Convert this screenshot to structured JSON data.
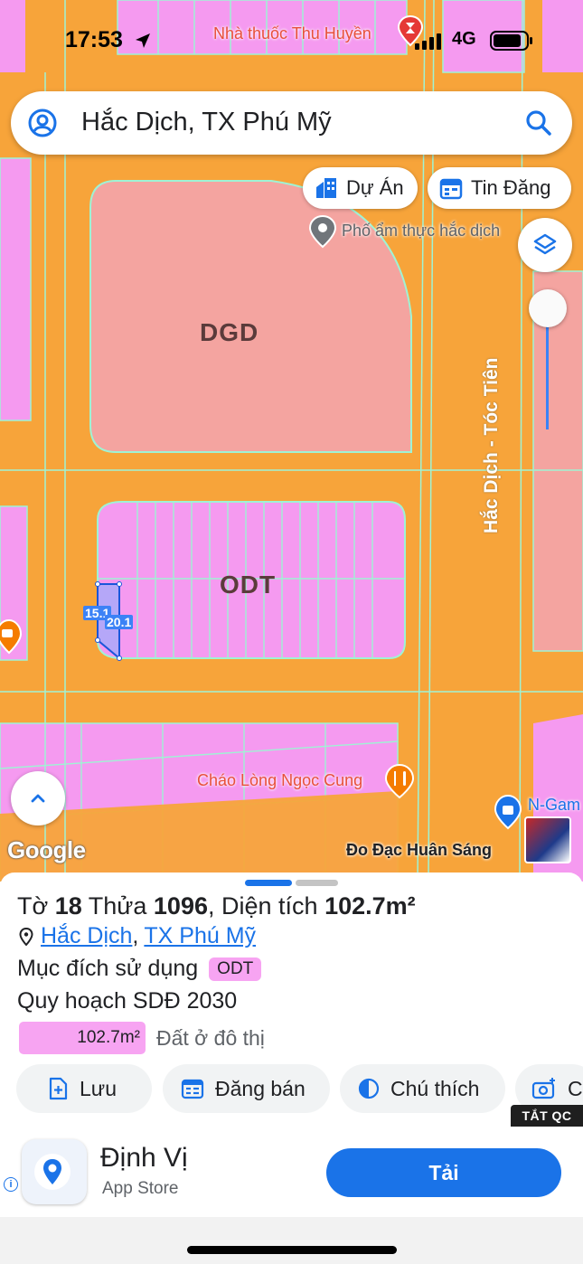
{
  "status_bar": {
    "time": "17:53",
    "network": "4G"
  },
  "search": {
    "query": "Hắc Dịch, TX Phú Mỹ"
  },
  "map": {
    "chips": {
      "projects": "Dự Án",
      "listings": "Tin Đăng"
    },
    "pois": {
      "pharmacy": "Nhà thuốc Thu Huyền",
      "food_street": "Phố ẩm thực hắc dịch",
      "restaurant": "Cháo Lòng Ngọc Cung",
      "game_shop": "N-Gam",
      "brand": "Đo Đạc Huân Sáng"
    },
    "zones": {
      "upper": "DGD",
      "middle": "ODT"
    },
    "road": "Hắc Dịch - Tóc Tiên",
    "dimensions": {
      "side_a": "15.1",
      "side_b": "20.1"
    },
    "google_logo": "Google"
  },
  "parcel": {
    "sheet_prefix": "Tờ",
    "sheet_no": "18",
    "parcel_prefix": "Thửa",
    "parcel_no": "1096",
    "area_prefix": "Diện tích",
    "area": "102.7m²",
    "ward": "Hắc Dịch",
    "town": "TX Phú Mỹ",
    "location_sep": ",",
    "purpose_label": "Mục đích sử dụng",
    "purpose_code": "ODT",
    "plan_label": "Quy hoạch SDĐ 2030",
    "plan_area": "102.7m²",
    "plan_desc": "Đất ở đô thị",
    "colors": {
      "odt": "#f7a4f2",
      "road": "#f7a43a",
      "dgd": "#f4a4a0"
    }
  },
  "actions": {
    "save": "Lưu",
    "post": "Đăng bán",
    "legend": "Chú thích",
    "photo": "C"
  },
  "ad": {
    "hide_label": "TẮT QC",
    "app_name": "Định Vị",
    "store": "App Store",
    "cta": "Tải",
    "info": "i"
  }
}
